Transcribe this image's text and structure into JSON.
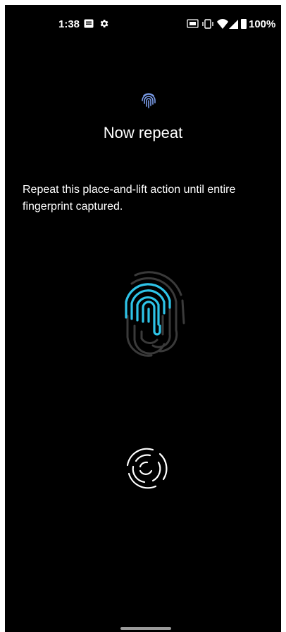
{
  "status_bar": {
    "time": "1:38",
    "battery": "100%",
    "icons": [
      "notification-icon",
      "settings-icon",
      "nfc-icon",
      "vibrate-icon",
      "wifi-icon",
      "signal-icon",
      "battery-icon"
    ]
  },
  "enroll": {
    "title": "Now repeat",
    "description": "Repeat this place-and-lift action until entire fingerprint captured.",
    "progress_color": "#2ec4e8"
  },
  "colors": {
    "background": "#000000",
    "text": "#ffffff",
    "accent": "#2ec4e8",
    "header_icon": "#7a9ce8"
  }
}
